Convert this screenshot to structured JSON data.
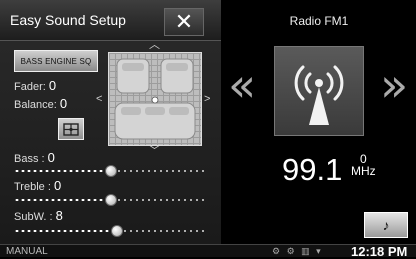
{
  "header": {
    "title": "Easy Sound Setup",
    "close_icon": "close-icon"
  },
  "bass_engine": {
    "label": "BASS ENGINE SQ"
  },
  "fader": {
    "label": "Fader:",
    "value": "0"
  },
  "balance": {
    "label": "Balance:",
    "value": "0"
  },
  "sliders": {
    "bass": {
      "label": "Bass :",
      "value": "0",
      "level": 0.5
    },
    "treble": {
      "label": "Treble :",
      "value": "0",
      "level": 0.5
    },
    "subw": {
      "label": "SubW. :",
      "value": "8",
      "level": 0.53
    }
  },
  "radio": {
    "title": "Radio FM1",
    "frequency": "99.1",
    "band_number": "0",
    "unit": "MHz"
  },
  "status": {
    "mode": "MANUAL",
    "time": "12:18 PM"
  },
  "icons": [
    "close-icon",
    "chevron-up-icon",
    "chevron-down-icon",
    "chevron-left-icon",
    "chevron-right-icon",
    "center-position-icon",
    "antenna-icon",
    "music-note-icon"
  ],
  "colors": {
    "panel": "#2b2b2b",
    "button": "#bdbdbd",
    "text": "#ffffff"
  }
}
